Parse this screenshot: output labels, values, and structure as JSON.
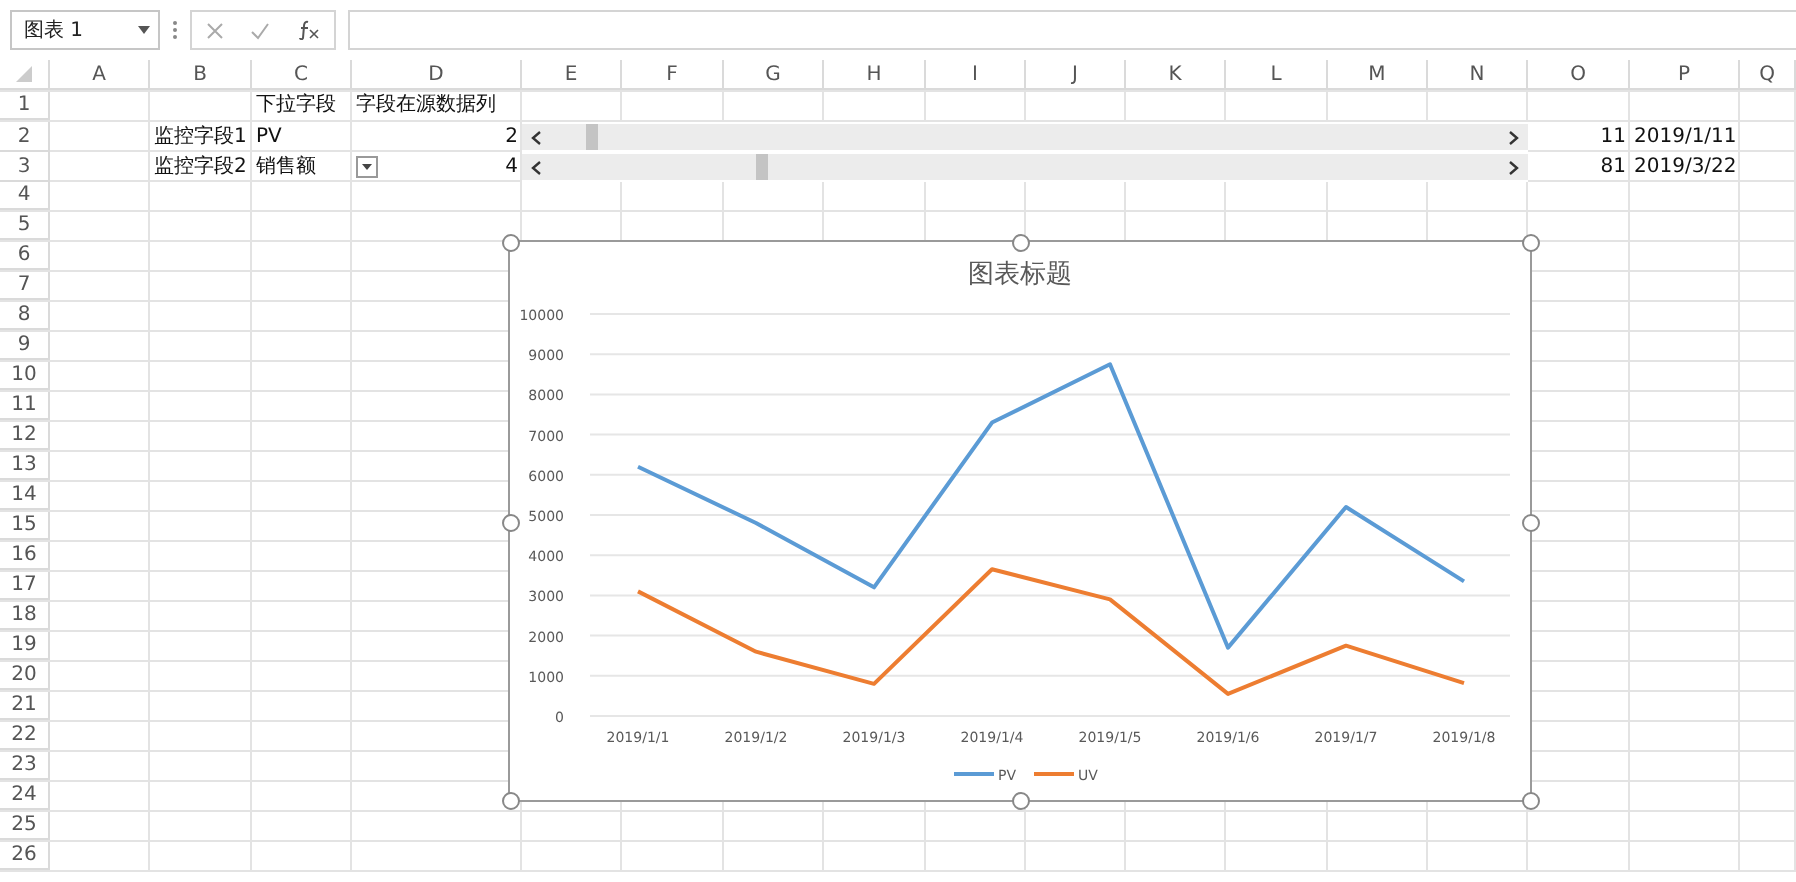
{
  "name_box": {
    "value": "图表 1"
  },
  "columns": [
    "A",
    "B",
    "C",
    "D",
    "E",
    "F",
    "G",
    "H",
    "I",
    "J",
    "K",
    "L",
    "M",
    "N",
    "O",
    "P",
    "Q"
  ],
  "rows": [
    {
      "number": "1",
      "c": "下拉字段",
      "d": {
        "value": "字段在源数据列",
        "kind": "text",
        "dropdown": false
      }
    },
    {
      "number": "2",
      "b": "监控字段1",
      "c": "PV",
      "d": {
        "value": "2",
        "kind": "number",
        "dropdown": false
      },
      "scrollbar": {
        "level": 0.038
      },
      "o": "11",
      "p": "2019/1/11"
    },
    {
      "number": "3",
      "b": "监控字段2",
      "c": "销售额",
      "d": {
        "value": "4",
        "kind": "number",
        "dropdown": true
      },
      "scrollbar": {
        "level": 0.22
      },
      "o": "81",
      "p": "2019/3/22"
    },
    {
      "number": "4"
    },
    {
      "number": "5"
    },
    {
      "number": "6"
    },
    {
      "number": "7"
    },
    {
      "number": "8"
    },
    {
      "number": "9"
    },
    {
      "number": "10"
    },
    {
      "number": "11"
    },
    {
      "number": "12"
    },
    {
      "number": "13"
    },
    {
      "number": "14"
    },
    {
      "number": "15"
    },
    {
      "number": "16"
    },
    {
      "number": "17"
    },
    {
      "number": "18"
    },
    {
      "number": "19"
    },
    {
      "number": "20"
    },
    {
      "number": "21"
    },
    {
      "number": "22"
    },
    {
      "number": "23"
    },
    {
      "number": "24"
    },
    {
      "number": "25"
    },
    {
      "number": "26"
    }
  ],
  "chart": {
    "selected": true,
    "chart_data": {
      "type": "line",
      "title": "图表标题",
      "categories": [
        "2019/1/1",
        "2019/1/2",
        "2019/1/3",
        "2019/1/4",
        "2019/1/5",
        "2019/1/6",
        "2019/1/7",
        "2019/1/8"
      ],
      "series": [
        {
          "name": "PV",
          "color": "#5b9bd5",
          "values": [
            6200,
            4800,
            3200,
            7300,
            8750,
            1700,
            5200,
            3350
          ]
        },
        {
          "name": "UV",
          "color": "#ed7d31",
          "values": [
            3100,
            1600,
            800,
            3650,
            2900,
            550,
            1750,
            820
          ]
        }
      ],
      "grid": true,
      "legend": "bottom",
      "ylim": [
        0,
        10000
      ],
      "yticks": [
        0,
        1000,
        2000,
        3000,
        4000,
        5000,
        6000,
        7000,
        8000,
        9000,
        10000
      ]
    }
  }
}
